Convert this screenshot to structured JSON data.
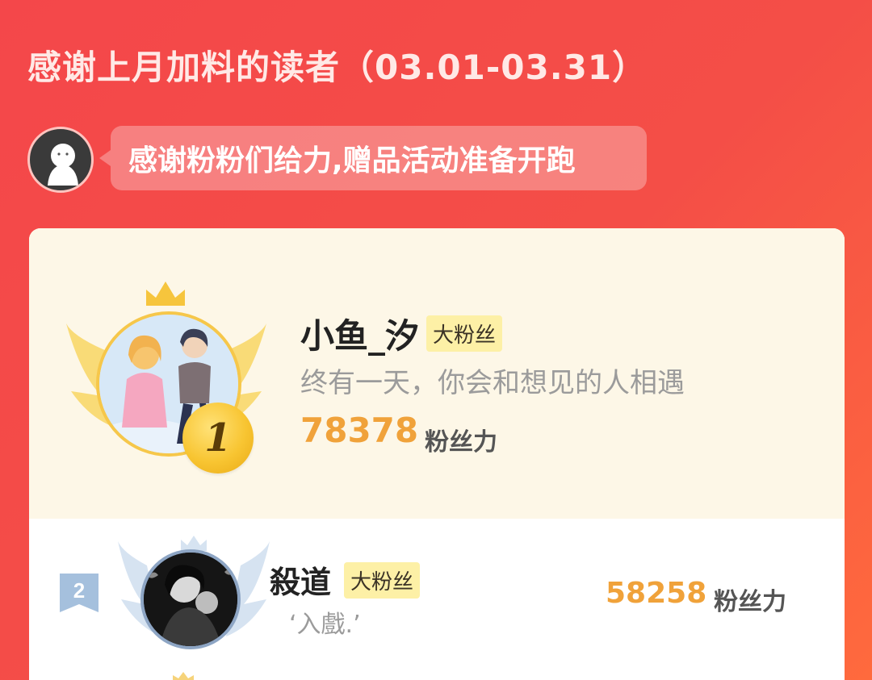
{
  "header": {
    "title": "感谢上月加料的读者（03.01-03.31）"
  },
  "announcement": {
    "text": "感谢粉粉们给力,赠品活动准备开跑",
    "avatar_icon": "ghost-avatar-icon"
  },
  "ranking": [
    {
      "rank": "1",
      "name": "小鱼_汐",
      "badge": "大粉丝",
      "motto": "终有一天，你会和想见的人相遇",
      "score": "78378",
      "score_unit": "粉丝力"
    },
    {
      "rank": "2",
      "name": "殺道",
      "badge": "大粉丝",
      "motto": "‘入戲.’",
      "score": "58258",
      "score_unit": "粉丝力"
    }
  ],
  "colors": {
    "background_red": "#f4474a",
    "card_cream": "#fdf7e7",
    "gold": "#f6c74a",
    "score_orange": "#f0a23a",
    "badge_yellow": "#fdf0a6",
    "silver": "#8da5c4"
  }
}
